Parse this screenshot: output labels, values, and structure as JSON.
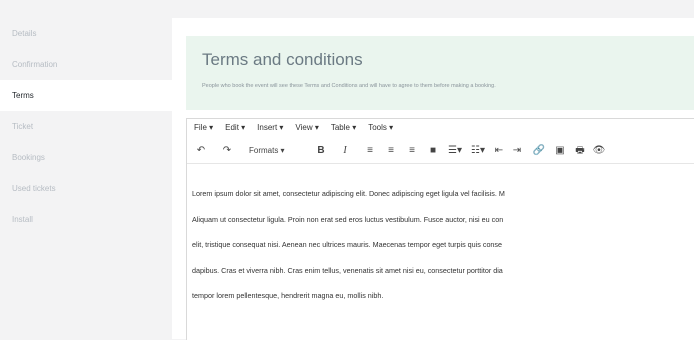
{
  "sidebar": {
    "items": [
      {
        "label": "Details",
        "active": false
      },
      {
        "label": "Confirmation",
        "active": false
      },
      {
        "label": "Terms",
        "active": true
      },
      {
        "label": "Ticket",
        "active": false
      },
      {
        "label": "Bookings",
        "active": false
      },
      {
        "label": "Used tickets",
        "active": false
      },
      {
        "label": "Install",
        "active": false
      }
    ]
  },
  "terms": {
    "title": "Terms and conditions",
    "description": "People who book the event will see these Terms and Conditions and will have to agree to them before making a booking."
  },
  "editor": {
    "menus": [
      "File ▾",
      "Edit ▾",
      "Insert ▾",
      "View ▾",
      "Table ▾",
      "Tools ▾"
    ],
    "formats_label": "Formats ▾",
    "content_lines": [
      "Lorem ipsum dolor sit amet, consectetur adipiscing elit. Donec adipiscing eget ligula vel facilisis. M",
      "Aliquam ut consectetur ligula. Proin non erat sed eros luctus vestibulum. Fusce auctor, nisi eu con",
      "elit, tristique consequat nisi. Aenean nec ultrices mauris. Maecenas tempor eget turpis quis conse",
      "dapibus. Cras et viverra nibh. Cras enim tellus, venenatis sit amet nisi eu, consectetur porttitor dia",
      "tempor lorem pellentesque, hendrerit magna eu, mollis nibh."
    ]
  }
}
